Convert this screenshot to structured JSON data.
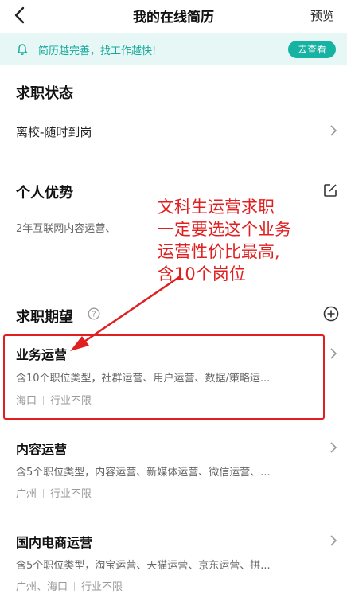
{
  "header": {
    "title": "我的在线简历",
    "preview_label": "预览"
  },
  "tip": {
    "text": "简历越完善，找工作越快!",
    "button_label": "去查看"
  },
  "job_status": {
    "title": "求职状态",
    "value": "离校-随时到岗"
  },
  "advantage": {
    "title": "个人优势",
    "text": "2年互联网内容运营、"
  },
  "annotation": {
    "lines": [
      "文科生运营求职",
      "一定要选这个业务",
      "运营性价比最高,",
      "含10个岗位"
    ]
  },
  "expectations": {
    "title": "求职期望",
    "items": [
      {
        "title": "业务运营",
        "types": "含10个职位类型，社群运营、用户运营、数据/策略运...",
        "location": "海口",
        "industry": "行业不限"
      },
      {
        "title": "内容运营",
        "types": "含5个职位类型，内容运营、新媒体运营、微信运营、...",
        "location": "广州",
        "industry": "行业不限"
      },
      {
        "title": "国内电商运营",
        "types": "含5个职位类型，淘宝运营、天猫运营、京东运营、拼...",
        "location": "广州、海口",
        "industry": "行业不限"
      }
    ]
  },
  "colors": {
    "accent": "#16b3a3",
    "tip_bg": "#e6f7f5",
    "annotation": "#e02020"
  }
}
